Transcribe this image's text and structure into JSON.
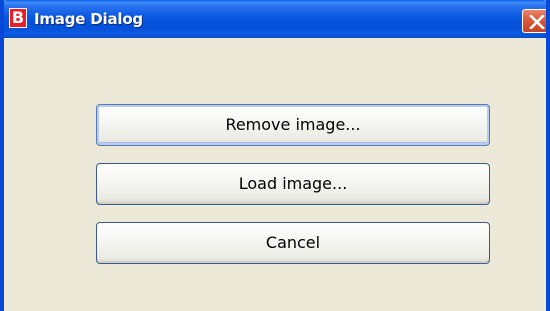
{
  "window": {
    "title": "Image Dialog",
    "app_icon_letter": "B"
  },
  "buttons": {
    "remove_label": "Remove image...",
    "load_label": "Load image...",
    "cancel_label": "Cancel"
  },
  "colors": {
    "titlebar": "#0a58e0",
    "frame": "#0848d8",
    "dialog_background": "#ece9d8",
    "close_button": "#d75a3a",
    "app_icon": "#e8202a"
  },
  "icons": {
    "app": "b-app-icon",
    "close": "close-icon"
  }
}
